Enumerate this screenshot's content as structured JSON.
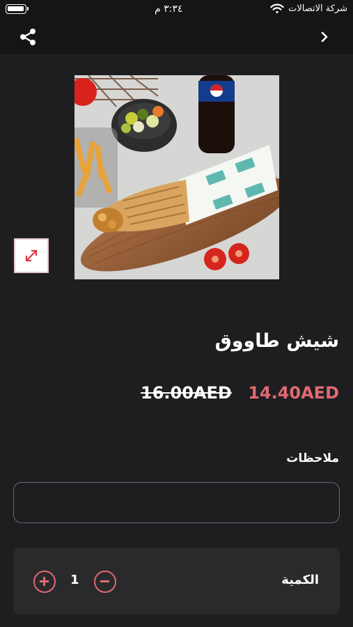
{
  "status_bar": {
    "carrier": "شركة الاتصالات",
    "time": "٣:٣٤ م"
  },
  "nav": {
    "share_icon": "share-icon",
    "back_icon": "chevron-right-icon"
  },
  "product": {
    "title": "شيش طاووق",
    "price_new": "14.40AED",
    "price_old": "16.00AED",
    "image_icon": "expand-icon"
  },
  "notes": {
    "label": "ملاحظات",
    "value": "",
    "placeholder": ""
  },
  "quantity": {
    "label": "الكمية",
    "value": "1"
  },
  "colors": {
    "accent": "#e06a72",
    "background": "#1e1e20",
    "card": "#2a2a2d"
  }
}
